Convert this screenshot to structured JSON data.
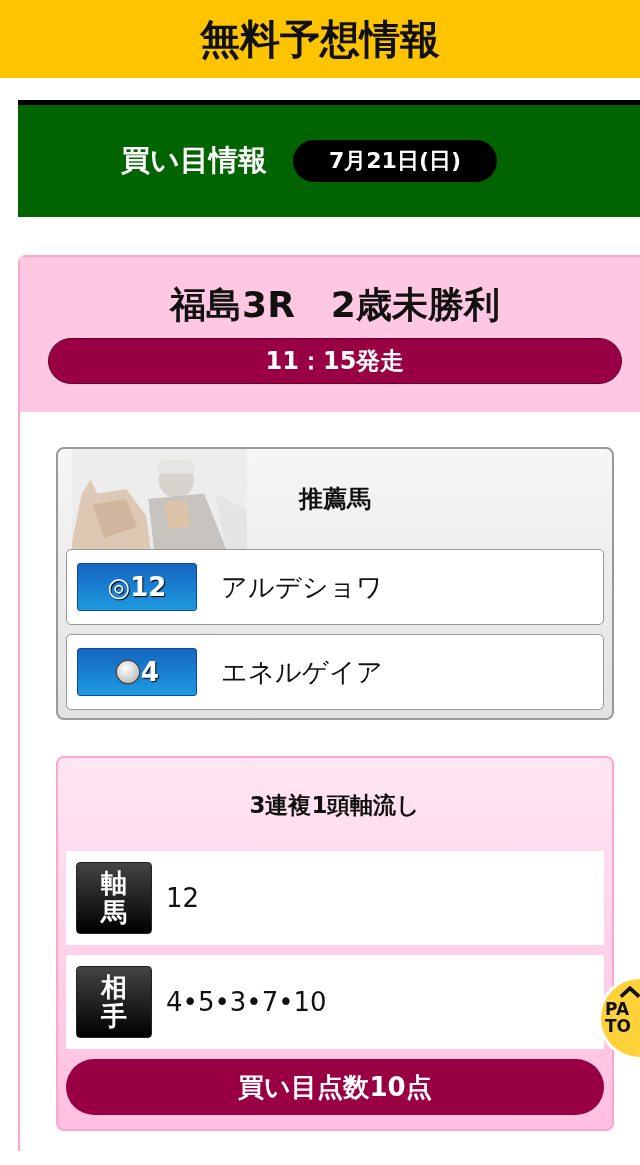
{
  "header": {
    "title": "無料予想情報"
  },
  "info_bar": {
    "title": "買い目情報",
    "date": "7月21日(日)"
  },
  "race": {
    "name": "福島3R　2歳未勝利",
    "start_time": "11：15発走"
  },
  "recommended": {
    "title": "推薦馬",
    "horses": [
      {
        "kind": "double_circle",
        "mark": "◎",
        "number": "12",
        "name": "アルデショワ"
      },
      {
        "kind": "ball",
        "number": "4",
        "name": "エネルゲイア"
      }
    ]
  },
  "bet": {
    "title": "3連複1頭軸流し",
    "rows": [
      {
        "label": "軸馬",
        "value": "12"
      },
      {
        "label": "相手",
        "value": "4•5•3•7•10"
      }
    ],
    "total": "買い目点数10点"
  },
  "page_top": {
    "lines": [
      "PA",
      "TO"
    ]
  }
}
